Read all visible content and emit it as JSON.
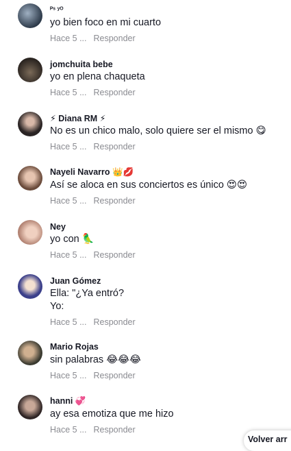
{
  "comments": [
    {
      "username": "ᴾˢ ʸᴼ",
      "text": "yo bien foco en mi cuarto",
      "time": "Hace 5 ...",
      "reply": "Responder",
      "avatar_color": "#2d3a4a"
    },
    {
      "username": "jomchuita bebe",
      "text": "yo en plena chaqueta",
      "time": "Hace 5 ...",
      "reply": "Responder",
      "avatar_color": "#3a3028"
    },
    {
      "username": "⚡ Diana RM ⚡",
      "text": "No es un chico malo, solo quiere ser el mismo 😋",
      "time": "Hace 5 ...",
      "reply": "Responder",
      "avatar_color": "#2a2424"
    },
    {
      "username": "Nayeli Navarro 👑💋",
      "text": "Así se aloca en sus conciertos es único 😍😍",
      "time": "Hace 5 ...",
      "reply": "Responder",
      "avatar_color": "#9a7a6a"
    },
    {
      "username": "Ney",
      "text": "yo con 🦜",
      "time": "Hace 5 ...",
      "reply": "Responder",
      "avatar_color": "#c9a08c"
    },
    {
      "username": "Juan Gómez",
      "text": "Ella: \"¿Ya entró?\nYo:",
      "time": "Hace 5 ...",
      "reply": "Responder",
      "avatar_color": "#3b3f8a"
    },
    {
      "username": "Mario Rojas",
      "text": "sin palabras 😂😂😂",
      "time": "Hace 5 ...",
      "reply": "Responder",
      "avatar_color": "#5a5a50"
    },
    {
      "username": "hanni 💞",
      "text": "ay esa emotiza que me hizo",
      "time": "Hace 5 ...",
      "reply": "Responder",
      "avatar_color": "#4a3838"
    }
  ],
  "back_button": "Volver arr"
}
